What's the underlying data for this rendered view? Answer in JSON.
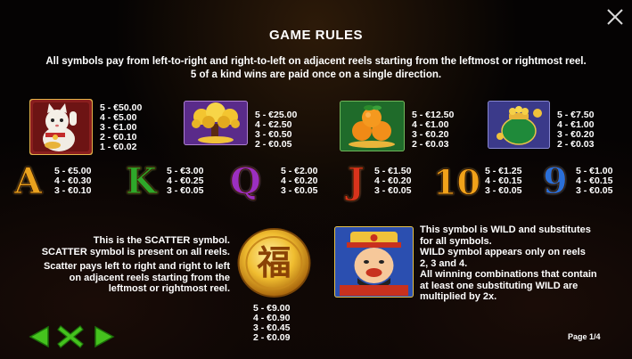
{
  "header": {
    "title": "GAME RULES",
    "intro_line1": "All symbols pay from left-to-right and right-to-left on adjacent reels starting from the leftmost or rightmost reel.",
    "intro_line2": "5 of a kind wins are paid once on a single direction."
  },
  "high_symbols": [
    {
      "icon": "lucky-cat",
      "pays": [
        "5 - €50.00",
        "4 - €5.00",
        "3 - €1.00",
        "2 - €0.10",
        "1 - €0.02"
      ]
    },
    {
      "icon": "money-tree",
      "pays": [
        "5 - €25.00",
        "4 - €2.50",
        "3 - €0.50",
        "2 - €0.05"
      ]
    },
    {
      "icon": "oranges",
      "pays": [
        "5 - €12.50",
        "4 - €1.00",
        "3 - €0.20",
        "2 - €0.03"
      ]
    },
    {
      "icon": "gold-pot",
      "pays": [
        "5 - €7.50",
        "4 - €1.00",
        "3 - €0.20",
        "2 - €0.03"
      ]
    }
  ],
  "low_symbols": [
    {
      "label": "A",
      "pays": [
        "5 - €5.00",
        "4 - €0.30",
        "3 - €0.10"
      ]
    },
    {
      "label": "K",
      "pays": [
        "5 - €3.00",
        "4 - €0.25",
        "3 - €0.05"
      ]
    },
    {
      "label": "Q",
      "pays": [
        "5 - €2.00",
        "4 - €0.20",
        "3 - €0.05"
      ]
    },
    {
      "label": "J",
      "pays": [
        "5 - €1.50",
        "4 - €0.20",
        "3 - €0.05"
      ]
    },
    {
      "label": "10",
      "pays": [
        "5 - €1.25",
        "4 - €0.15",
        "3 - €0.05"
      ]
    },
    {
      "label": "9",
      "pays": [
        "5 - €1.00",
        "4 - €0.15",
        "3 - €0.05"
      ]
    }
  ],
  "scatter": {
    "icon": "fu-coin",
    "glyph": "福",
    "lines": [
      "This is the SCATTER symbol.",
      "SCATTER symbol is present on all reels.",
      "Scatter pays left to right and right to left",
      "on adjacent reels starting from the",
      "leftmost or rightmost reel."
    ],
    "pays": [
      "5 - €9.00",
      "4 - €0.90",
      "3 - €0.45",
      "2 - €0.09"
    ]
  },
  "wild": {
    "icon": "fortune-god",
    "lines": [
      "This symbol is WILD and substitutes",
      "for all symbols.",
      "WILD symbol appears only on reels",
      "2, 3 and 4.",
      "All winning combinations that contain",
      "at least one substituting WILD are",
      "multiplied by 2x."
    ]
  },
  "footer": {
    "page_label": "Page 1/4",
    "prev_icon": "arrow-left-icon",
    "close_icon": "x-icon",
    "next_icon": "arrow-right-icon"
  },
  "colors": {
    "nav_green": "#45c21e",
    "background": "#050303"
  }
}
